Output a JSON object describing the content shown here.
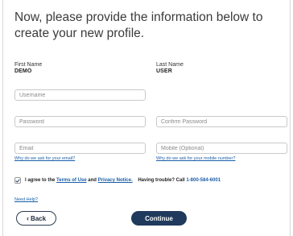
{
  "heading": "Now, please provide the information below to create your new profile.",
  "name": {
    "first_label": "First Name",
    "first_value": "DEMO",
    "last_label": "Last Name",
    "last_value": "USER"
  },
  "fields": {
    "username_placeholder": "Username",
    "password_placeholder": "Password",
    "confirm_password_placeholder": "Confirm Password",
    "email_placeholder": "Email",
    "mobile_placeholder": "Mobile (Optional)"
  },
  "links": {
    "why_email": "Why do we ask for your email?",
    "why_mobile": "Why do we ask for your mobile number?",
    "need_help": "Need Help?"
  },
  "agreement": {
    "prefix": "I agree to the",
    "terms": "Terms of Use",
    "and": "and",
    "privacy": "Privacy Notice.",
    "trouble": "Having trouble? Call",
    "phone": "1-800-584-6001",
    "checked": true
  },
  "buttons": {
    "back": "Back",
    "continue": "Continue"
  },
  "colors": {
    "primary": "#1f3a5c",
    "link": "#1a5ea8"
  },
  "icons": {
    "checkmark": "checkmark-icon",
    "back_chevron": "chevron-left-icon"
  }
}
